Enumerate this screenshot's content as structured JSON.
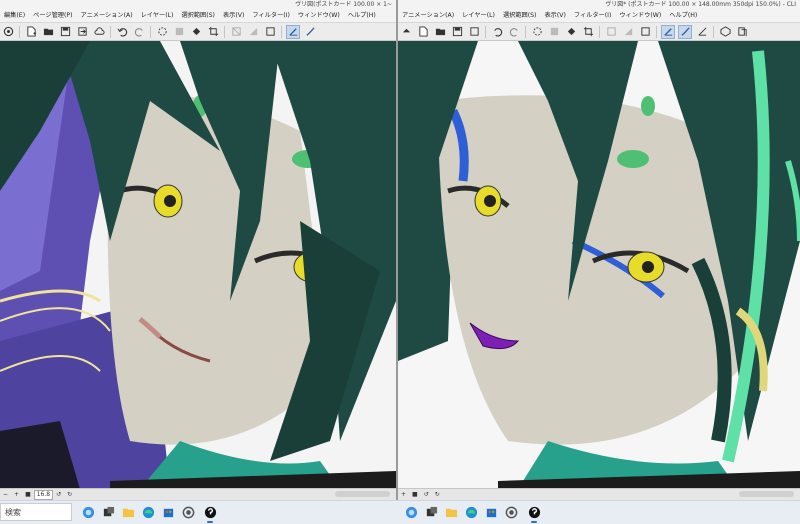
{
  "left_window": {
    "title": "ヴリ図(ポストカード 100.00 × 1~",
    "menus": [
      "編集(E)",
      "ページ管理(P)",
      "アニメーション(A)",
      "レイヤー(L)",
      "選択範囲(S)",
      "表示(V)",
      "フィルター(I)",
      "ウィンドウ(W)",
      "ヘルプ(H)"
    ],
    "status": {
      "zoom": "16.8"
    }
  },
  "right_window": {
    "title": "ヴリ図* (ポストカード 100.00 × 148.00mm 350dpi 150.0%) - CLI",
    "menus": [
      "アニメーション(A)",
      "レイヤー(L)",
      "選択範囲(S)",
      "表示(V)",
      "フィルター(I)",
      "ウィンドウ(W)",
      "ヘルプ(H)"
    ]
  },
  "taskbar": {
    "search_placeholder": "検索",
    "apps": [
      "copilot-icon",
      "file-explorer-icon",
      "edge-icon",
      "store-icon",
      "app-icon",
      "clip-studio-icon"
    ]
  },
  "colors": {
    "hair": "#1f4a43",
    "accent_green": "#5ee0a6",
    "skin": "#d4d1c4",
    "eye": "#e8dc2a",
    "lips_left": "#c48b84",
    "lips_right": "#7d1fb5",
    "outfit_purple": "#5e4fb3",
    "selection_blue": "#c7d8ea"
  }
}
